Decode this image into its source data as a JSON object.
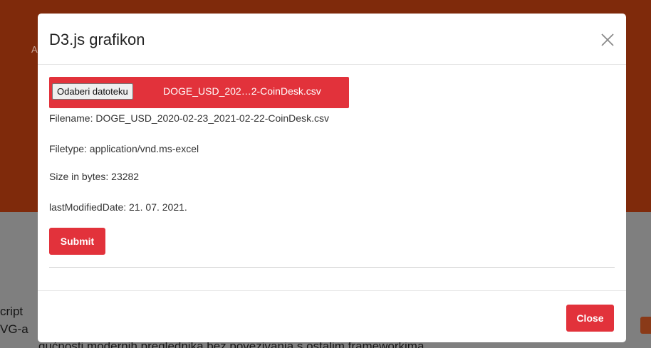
{
  "background": {
    "partial_letter": "A",
    "text_line_1": "cript",
    "text_line_2": "VG-a",
    "text_line_3": "gućnosti modernih preglednika bez povezivanja s ostalim frameworkima"
  },
  "modal": {
    "title": "D3.js grafikon",
    "close_icon": "close-icon",
    "file_input": {
      "button_label": "Odaberi datoteku",
      "selected_file": "DOGE_USD_202…2-CoinDesk.csv"
    },
    "file_info": {
      "filename": "Filename: DOGE_USD_2020-02-23_2021-02-22-CoinDesk.csv",
      "filetype": "Filetype: application/vnd.ms-excel",
      "size": "Size in bytes: 23282",
      "last_modified": "lastModifiedDate: 21. 07. 2021."
    },
    "submit_label": "Submit",
    "close_label": "Close"
  },
  "colors": {
    "accent": "#e2323b",
    "header_bg_dimmed": "#7f2a0b",
    "backdrop": "#7f7f7f"
  }
}
